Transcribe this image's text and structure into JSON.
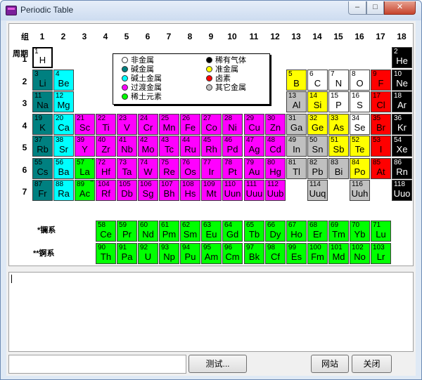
{
  "window": {
    "title": "Periodic Table",
    "min_glyph": "–",
    "max_glyph": "□",
    "close_glyph": "✕"
  },
  "labels": {
    "group_header": "组",
    "period_header": "周期",
    "lanthanide_label": "*镧系",
    "actinide_label": "**锕系"
  },
  "groups": [
    "1",
    "2",
    "3",
    "4",
    "5",
    "6",
    "7",
    "8",
    "9",
    "10",
    "11",
    "12",
    "13",
    "14",
    "15",
    "16",
    "17",
    "18"
  ],
  "periods": [
    "1",
    "2",
    "3",
    "4",
    "5",
    "6",
    "7"
  ],
  "legend": [
    {
      "label": "非金属",
      "color": "#ffffff"
    },
    {
      "label": "碱金属",
      "color": "#008080"
    },
    {
      "label": "碱土金属",
      "color": "#00ffff"
    },
    {
      "label": "过渡金属",
      "color": "#ff00ff"
    },
    {
      "label": "稀土元素",
      "color": "#00ff00"
    },
    {
      "label": "稀有气体",
      "color": "#000000"
    },
    {
      "label": "准金属",
      "color": "#ffff00"
    },
    {
      "label": "卤素",
      "color": "#ff0000"
    },
    {
      "label": "其它金属",
      "color": "#c0c0c0"
    }
  ],
  "categories": {
    "nonmetal": {
      "bg": "#ffffff",
      "fg": "#000000"
    },
    "alkali": {
      "bg": "#008080",
      "fg": "#000000"
    },
    "alkaline": {
      "bg": "#00ffff",
      "fg": "#000000"
    },
    "transition": {
      "bg": "#ff00ff",
      "fg": "#000000"
    },
    "rareearth": {
      "bg": "#00ff00",
      "fg": "#000000"
    },
    "noble": {
      "bg": "#000000",
      "fg": "#ffffff"
    },
    "metalloid": {
      "bg": "#ffff00",
      "fg": "#000000"
    },
    "halogen": {
      "bg": "#ff0000",
      "fg": "#000000"
    },
    "othermetal": {
      "bg": "#c0c0c0",
      "fg": "#000000"
    }
  },
  "elements": [
    {
      "n": "1",
      "s": "H",
      "cat": "nonmetal",
      "g": 1,
      "p": 1,
      "selected": true
    },
    {
      "n": "2",
      "s": "He",
      "cat": "noble",
      "g": 18,
      "p": 1
    },
    {
      "n": "3",
      "s": "Li",
      "cat": "alkali",
      "g": 1,
      "p": 2
    },
    {
      "n": "4",
      "s": "Be",
      "cat": "alkaline",
      "g": 2,
      "p": 2
    },
    {
      "n": "5",
      "s": "B",
      "cat": "metalloid",
      "g": 13,
      "p": 2
    },
    {
      "n": "6",
      "s": "C",
      "cat": "nonmetal",
      "g": 14,
      "p": 2
    },
    {
      "n": "7",
      "s": "N",
      "cat": "nonmetal",
      "g": 15,
      "p": 2
    },
    {
      "n": "8",
      "s": "O",
      "cat": "nonmetal",
      "g": 16,
      "p": 2
    },
    {
      "n": "9",
      "s": "F",
      "cat": "halogen",
      "g": 17,
      "p": 2
    },
    {
      "n": "10",
      "s": "Ne",
      "cat": "noble",
      "g": 18,
      "p": 2
    },
    {
      "n": "11",
      "s": "Na",
      "cat": "alkali",
      "g": 1,
      "p": 3
    },
    {
      "n": "12",
      "s": "Mg",
      "cat": "alkaline",
      "g": 2,
      "p": 3
    },
    {
      "n": "13",
      "s": "Al",
      "cat": "othermetal",
      "g": 13,
      "p": 3
    },
    {
      "n": "14",
      "s": "Si",
      "cat": "metalloid",
      "g": 14,
      "p": 3
    },
    {
      "n": "15",
      "s": "P",
      "cat": "nonmetal",
      "g": 15,
      "p": 3
    },
    {
      "n": "16",
      "s": "S",
      "cat": "nonmetal",
      "g": 16,
      "p": 3
    },
    {
      "n": "17",
      "s": "Cl",
      "cat": "halogen",
      "g": 17,
      "p": 3
    },
    {
      "n": "18",
      "s": "Ar",
      "cat": "noble",
      "g": 18,
      "p": 3
    },
    {
      "n": "19",
      "s": "K",
      "cat": "alkali",
      "g": 1,
      "p": 4
    },
    {
      "n": "20",
      "s": "Ca",
      "cat": "alkaline",
      "g": 2,
      "p": 4
    },
    {
      "n": "21",
      "s": "Sc",
      "cat": "transition",
      "g": 3,
      "p": 4
    },
    {
      "n": "22",
      "s": "Ti",
      "cat": "transition",
      "g": 4,
      "p": 4
    },
    {
      "n": "23",
      "s": "V",
      "cat": "transition",
      "g": 5,
      "p": 4
    },
    {
      "n": "24",
      "s": "Cr",
      "cat": "transition",
      "g": 6,
      "p": 4
    },
    {
      "n": "25",
      "s": "Mn",
      "cat": "transition",
      "g": 7,
      "p": 4
    },
    {
      "n": "26",
      "s": "Fe",
      "cat": "transition",
      "g": 8,
      "p": 4
    },
    {
      "n": "27",
      "s": "Co",
      "cat": "transition",
      "g": 9,
      "p": 4
    },
    {
      "n": "28",
      "s": "Ni",
      "cat": "transition",
      "g": 10,
      "p": 4
    },
    {
      "n": "29",
      "s": "Cu",
      "cat": "transition",
      "g": 11,
      "p": 4
    },
    {
      "n": "30",
      "s": "Zn",
      "cat": "transition",
      "g": 12,
      "p": 4
    },
    {
      "n": "31",
      "s": "Ga",
      "cat": "othermetal",
      "g": 13,
      "p": 4
    },
    {
      "n": "32",
      "s": "Ge",
      "cat": "metalloid",
      "g": 14,
      "p": 4
    },
    {
      "n": "33",
      "s": "As",
      "cat": "metalloid",
      "g": 15,
      "p": 4
    },
    {
      "n": "34",
      "s": "Se",
      "cat": "nonmetal",
      "g": 16,
      "p": 4
    },
    {
      "n": "35",
      "s": "Br",
      "cat": "halogen",
      "g": 17,
      "p": 4
    },
    {
      "n": "36",
      "s": "Kr",
      "cat": "noble",
      "g": 18,
      "p": 4
    },
    {
      "n": "37",
      "s": "Rb",
      "cat": "alkali",
      "g": 1,
      "p": 5
    },
    {
      "n": "38",
      "s": "Sr",
      "cat": "alkaline",
      "g": 2,
      "p": 5
    },
    {
      "n": "39",
      "s": "Y",
      "cat": "transition",
      "g": 3,
      "p": 5
    },
    {
      "n": "40",
      "s": "Zr",
      "cat": "transition",
      "g": 4,
      "p": 5
    },
    {
      "n": "41",
      "s": "Nb",
      "cat": "transition",
      "g": 5,
      "p": 5
    },
    {
      "n": "42",
      "s": "Mo",
      "cat": "transition",
      "g": 6,
      "p": 5
    },
    {
      "n": "43",
      "s": "Tc",
      "cat": "transition",
      "g": 7,
      "p": 5
    },
    {
      "n": "44",
      "s": "Ru",
      "cat": "transition",
      "g": 8,
      "p": 5
    },
    {
      "n": "45",
      "s": "Rh",
      "cat": "transition",
      "g": 9,
      "p": 5
    },
    {
      "n": "46",
      "s": "Pd",
      "cat": "transition",
      "g": 10,
      "p": 5
    },
    {
      "n": "47",
      "s": "Ag",
      "cat": "transition",
      "g": 11,
      "p": 5
    },
    {
      "n": "48",
      "s": "Cd",
      "cat": "transition",
      "g": 12,
      "p": 5
    },
    {
      "n": "49",
      "s": "In",
      "cat": "othermetal",
      "g": 13,
      "p": 5
    },
    {
      "n": "50",
      "s": "Sn",
      "cat": "othermetal",
      "g": 14,
      "p": 5
    },
    {
      "n": "51",
      "s": "Sb",
      "cat": "metalloid",
      "g": 15,
      "p": 5
    },
    {
      "n": "52",
      "s": "Te",
      "cat": "metalloid",
      "g": 16,
      "p": 5
    },
    {
      "n": "53",
      "s": "I",
      "cat": "halogen",
      "g": 17,
      "p": 5
    },
    {
      "n": "54",
      "s": "Xe",
      "cat": "noble",
      "g": 18,
      "p": 5
    },
    {
      "n": "55",
      "s": "Cs",
      "cat": "alkali",
      "g": 1,
      "p": 6
    },
    {
      "n": "56",
      "s": "Ba",
      "cat": "alkaline",
      "g": 2,
      "p": 6
    },
    {
      "n": "57",
      "s": "La",
      "cat": "rareearth",
      "g": 3,
      "p": 6,
      "mark": "*"
    },
    {
      "n": "72",
      "s": "Hf",
      "cat": "transition",
      "g": 4,
      "p": 6
    },
    {
      "n": "73",
      "s": "Ta",
      "cat": "transition",
      "g": 5,
      "p": 6
    },
    {
      "n": "74",
      "s": "W",
      "cat": "transition",
      "g": 6,
      "p": 6
    },
    {
      "n": "75",
      "s": "Re",
      "cat": "transition",
      "g": 7,
      "p": 6
    },
    {
      "n": "76",
      "s": "Os",
      "cat": "transition",
      "g": 8,
      "p": 6
    },
    {
      "n": "77",
      "s": "Ir",
      "cat": "transition",
      "g": 9,
      "p": 6
    },
    {
      "n": "78",
      "s": "Pt",
      "cat": "transition",
      "g": 10,
      "p": 6
    },
    {
      "n": "79",
      "s": "Au",
      "cat": "transition",
      "g": 11,
      "p": 6
    },
    {
      "n": "80",
      "s": "Hg",
      "cat": "transition",
      "g": 12,
      "p": 6
    },
    {
      "n": "81",
      "s": "Tl",
      "cat": "othermetal",
      "g": 13,
      "p": 6
    },
    {
      "n": "82",
      "s": "Pb",
      "cat": "othermetal",
      "g": 14,
      "p": 6
    },
    {
      "n": "83",
      "s": "Bi",
      "cat": "othermetal",
      "g": 15,
      "p": 6
    },
    {
      "n": "84",
      "s": "Po",
      "cat": "metalloid",
      "g": 16,
      "p": 6
    },
    {
      "n": "85",
      "s": "At",
      "cat": "halogen",
      "g": 17,
      "p": 6
    },
    {
      "n": "86",
      "s": "Rn",
      "cat": "noble",
      "g": 18,
      "p": 6
    },
    {
      "n": "87",
      "s": "Fr",
      "cat": "alkali",
      "g": 1,
      "p": 7
    },
    {
      "n": "88",
      "s": "Ra",
      "cat": "alkaline",
      "g": 2,
      "p": 7
    },
    {
      "n": "89",
      "s": "Ac",
      "cat": "rareearth",
      "g": 3,
      "p": 7,
      "mark": "**"
    },
    {
      "n": "104",
      "s": "Rf",
      "cat": "transition",
      "g": 4,
      "p": 7
    },
    {
      "n": "105",
      "s": "Db",
      "cat": "transition",
      "g": 5,
      "p": 7
    },
    {
      "n": "106",
      "s": "Sg",
      "cat": "transition",
      "g": 6,
      "p": 7
    },
    {
      "n": "107",
      "s": "Bh",
      "cat": "transition",
      "g": 7,
      "p": 7
    },
    {
      "n": "108",
      "s": "Hs",
      "cat": "transition",
      "g": 8,
      "p": 7
    },
    {
      "n": "109",
      "s": "Mt",
      "cat": "transition",
      "g": 9,
      "p": 7
    },
    {
      "n": "110",
      "s": "Uun",
      "cat": "transition",
      "g": 10,
      "p": 7
    },
    {
      "n": "111",
      "s": "Uuu",
      "cat": "transition",
      "g": 11,
      "p": 7
    },
    {
      "n": "112",
      "s": "Uub",
      "cat": "transition",
      "g": 12,
      "p": 7
    },
    {
      "n": "114",
      "s": "Uuq",
      "cat": "othermetal",
      "g": 14,
      "p": 7
    },
    {
      "n": "116",
      "s": "Uuh",
      "cat": "othermetal",
      "g": 16,
      "p": 7
    },
    {
      "n": "118",
      "s": "Uuo",
      "cat": "noble",
      "g": 18,
      "p": 7
    }
  ],
  "lanthanides": [
    {
      "n": "58",
      "s": "Ce"
    },
    {
      "n": "59",
      "s": "Pr"
    },
    {
      "n": "60",
      "s": "Nd"
    },
    {
      "n": "61",
      "s": "Pm"
    },
    {
      "n": "62",
      "s": "Sm"
    },
    {
      "n": "63",
      "s": "Eu"
    },
    {
      "n": "64",
      "s": "Gd"
    },
    {
      "n": "65",
      "s": "Tb"
    },
    {
      "n": "66",
      "s": "Dy"
    },
    {
      "n": "67",
      "s": "Ho"
    },
    {
      "n": "68",
      "s": "Er"
    },
    {
      "n": "69",
      "s": "Tm"
    },
    {
      "n": "70",
      "s": "Yb"
    },
    {
      "n": "71",
      "s": "Lu"
    }
  ],
  "actinides": [
    {
      "n": "90",
      "s": "Th"
    },
    {
      "n": "91",
      "s": "Pa"
    },
    {
      "n": "92",
      "s": "U"
    },
    {
      "n": "93",
      "s": "Np"
    },
    {
      "n": "94",
      "s": "Pu"
    },
    {
      "n": "95",
      "s": "Am"
    },
    {
      "n": "96",
      "s": "Cm"
    },
    {
      "n": "97",
      "s": "Bk"
    },
    {
      "n": "98",
      "s": "Cf"
    },
    {
      "n": "99",
      "s": "Es"
    },
    {
      "n": "100",
      "s": "Fm"
    },
    {
      "n": "101",
      "s": "Md"
    },
    {
      "n": "102",
      "s": "No"
    },
    {
      "n": "103",
      "s": "Lr"
    }
  ],
  "controls": {
    "input_value": "",
    "test_button": "测试...",
    "website_button": "网站",
    "close_button": "关闭"
  }
}
